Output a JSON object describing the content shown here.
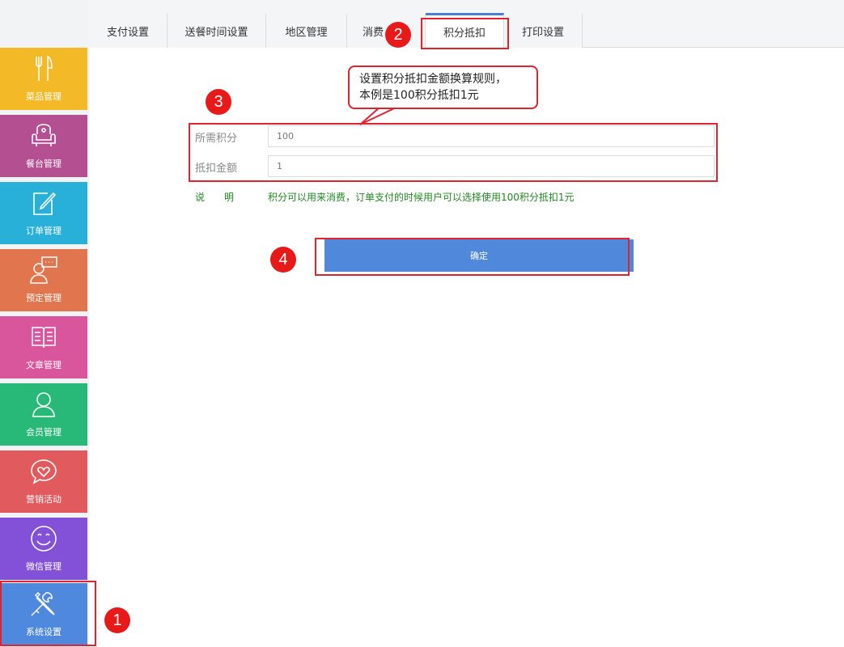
{
  "sidebar": {
    "items": [
      {
        "label": "菜品管理",
        "icon": "utensils-icon",
        "color": "#f3b927"
      },
      {
        "label": "餐台管理",
        "icon": "armchair-icon",
        "color": "#b44f92"
      },
      {
        "label": "订单管理",
        "icon": "edit-note-icon",
        "color": "#29b0d8"
      },
      {
        "label": "预定管理",
        "icon": "person-chat-icon",
        "color": "#e1754e"
      },
      {
        "label": "文章管理",
        "icon": "book-icon",
        "color": "#d9559c"
      },
      {
        "label": "会员管理",
        "icon": "user-icon",
        "color": "#28b978"
      },
      {
        "label": "营销活动",
        "icon": "heart-bubble-icon",
        "color": "#e15a5e"
      },
      {
        "label": "微信管理",
        "icon": "smiley-icon",
        "color": "#8351d8"
      },
      {
        "label": "系统设置",
        "icon": "tools-icon",
        "color": "#4f89de"
      }
    ]
  },
  "tabs": [
    {
      "label": "支付设置"
    },
    {
      "label": "送餐时间设置"
    },
    {
      "label": "地区管理"
    },
    {
      "label": "消费"
    },
    {
      "label": "积分抵扣"
    },
    {
      "label": "打印设置"
    }
  ],
  "active_tab": "积分抵扣",
  "form": {
    "points_label": "所需积分",
    "points_value": "100",
    "amount_label": "抵扣金额",
    "amount_value": "1",
    "note_label": "说　　明",
    "note_text": "积分可以用来消费，订单支付的时候用户可以选择使用100积分抵扣1元",
    "confirm_label": "确定"
  },
  "annotations": {
    "callout_line1": "设置积分抵扣金额换算规则，",
    "callout_line2": "本例是100积分抵扣1元",
    "badge1": "1",
    "badge2": "2",
    "badge3": "3",
    "badge4": "4"
  },
  "colors": {
    "accent": "#4f89de",
    "annotation_red": "#e0232d",
    "note_green": "#1e8a1e"
  }
}
